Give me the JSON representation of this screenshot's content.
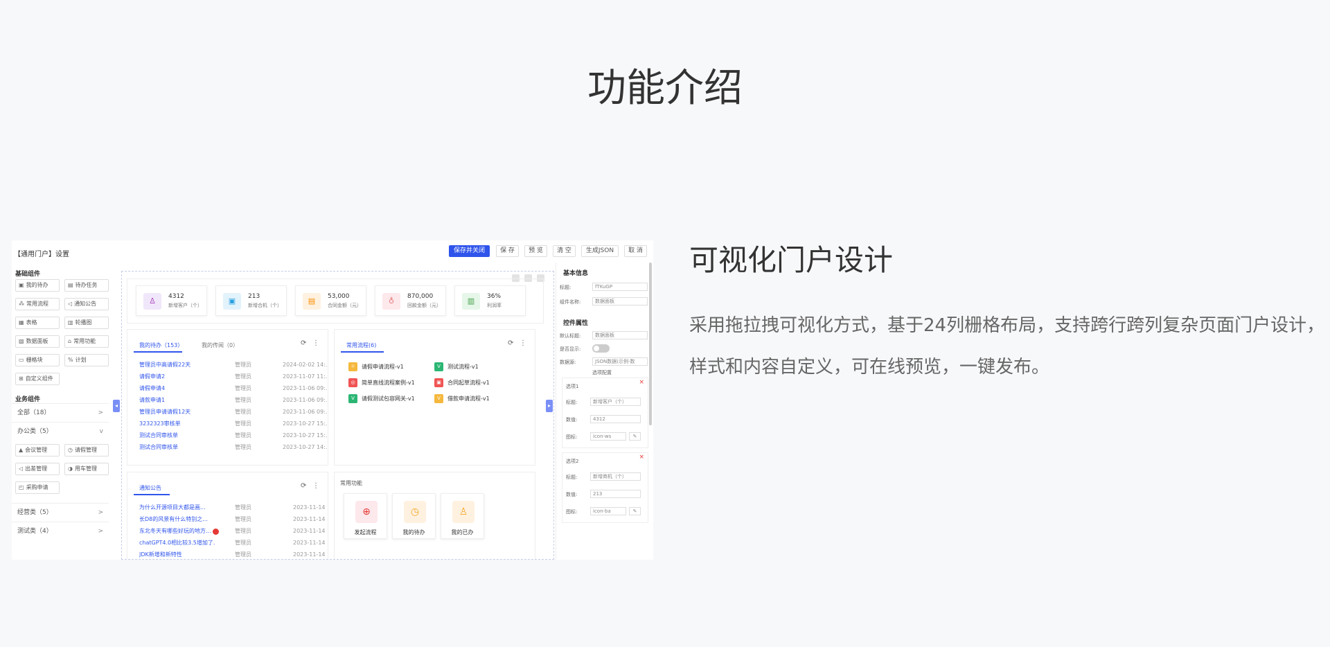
{
  "page": {
    "title": "功能介绍",
    "feature_title": "可视化门户设计",
    "feature_desc": "采用拖拉拽可视化方式，基于24列栅格布局，支持跨行跨列复杂页面门户设计，样式和内容自定义，可在线预览，一键发布。"
  },
  "toolbar": {
    "title": "【通用门户】设置",
    "buttons": [
      "保存并关闭",
      "保 存",
      "预 览",
      "清 空",
      "生成JSON",
      "取 消"
    ]
  },
  "sidebar": {
    "basic_title": "基础组件",
    "basic_items": [
      {
        "icon": "▣",
        "label": "我的待办"
      },
      {
        "icon": "▤",
        "label": "待办任务"
      },
      {
        "icon": "⁂",
        "label": "常用流程"
      },
      {
        "icon": "◁",
        "label": "通知公告"
      },
      {
        "icon": "▦",
        "label": "表格"
      },
      {
        "icon": "▥",
        "label": "轮播图"
      },
      {
        "icon": "▧",
        "label": "数据面板"
      },
      {
        "icon": "⌂",
        "label": "常用功能"
      },
      {
        "icon": "▭",
        "label": "栅格块"
      },
      {
        "icon": "%",
        "label": "计划"
      },
      {
        "icon": "⊞",
        "label": "自定义组件"
      }
    ],
    "business_title": "业务组件",
    "groups": [
      {
        "label": "全部（18）",
        "chevron": ">"
      },
      {
        "label": "办公类（5）",
        "chevron": "v"
      },
      {
        "label": "经营类（5）",
        "chevron": ">"
      },
      {
        "label": "测试类（4）",
        "chevron": ">"
      }
    ],
    "office_items": [
      {
        "icon": "▲",
        "label": "会议管理"
      },
      {
        "icon": "◷",
        "label": "请假管理"
      },
      {
        "icon": "◁",
        "label": "出差管理"
      },
      {
        "icon": "◑",
        "label": "用车管理"
      },
      {
        "icon": "◰",
        "label": "采购申请"
      }
    ]
  },
  "stats": [
    {
      "value": "4312",
      "label": "新增客户（个）",
      "icon": "user-icon",
      "glyph": "♙",
      "bg": "#f1e7fb",
      "fg": "#9c27b0"
    },
    {
      "value": "213",
      "label": "新增合机（个）",
      "icon": "calendar-icon",
      "glyph": "▣",
      "bg": "#e3f3fc",
      "fg": "#29a1e0"
    },
    {
      "value": "53,000",
      "label": "合同金额（元）",
      "icon": "document-icon",
      "glyph": "▤",
      "bg": "#fff1e0",
      "fg": "#fb8c00"
    },
    {
      "value": "870,000",
      "label": "回款金额（元）",
      "icon": "money-bag-icon",
      "glyph": "♁",
      "bg": "#fde8ec",
      "fg": "#e57373"
    },
    {
      "value": "36%",
      "label": "利润率",
      "icon": "bar-chart-icon",
      "glyph": "▥",
      "bg": "#e6f6e9",
      "fg": "#43a047"
    }
  ],
  "todo": {
    "tabs": [
      "我的待办（153）",
      "我的传阅（0）"
    ],
    "rows": [
      {
        "title": "管理员中高请假22天",
        "user": "管理员",
        "date": "2024-02-02 14:..."
      },
      {
        "title": "请假申请2",
        "user": "管理员",
        "date": "2023-11-07 11:..."
      },
      {
        "title": "请假申请4",
        "user": "管理员",
        "date": "2023-11-06 09:..."
      },
      {
        "title": "请款申请1",
        "user": "管理员",
        "date": "2023-11-06 09:..."
      },
      {
        "title": "管理员申请请假12天",
        "user": "管理员",
        "date": "2023-11-06 09:..."
      },
      {
        "title": "3232323审核单",
        "user": "管理员",
        "date": "2023-10-27 15:..."
      },
      {
        "title": "测试合同审核单",
        "user": "管理员",
        "date": "2023-10-27 15:..."
      },
      {
        "title": "测试合同审核单",
        "user": "管理员",
        "date": "2023-10-27 14:..."
      }
    ]
  },
  "processes": {
    "tab": "常用流程(6)",
    "items": [
      {
        "label": "请假申请流程-v1",
        "badge": "☼",
        "color": "#f5b83d"
      },
      {
        "label": "测试流程-v1",
        "badge": "V",
        "color": "#2bb673"
      },
      {
        "label": "简单直线流程案例-v1",
        "badge": "◎",
        "color": "#f05454"
      },
      {
        "label": "合同起草流程-v1",
        "badge": "▣",
        "color": "#f05454"
      },
      {
        "label": "请假测试包容网关-v1",
        "badge": "V",
        "color": "#2bb673"
      },
      {
        "label": "借款申请流程-v1",
        "badge": "V",
        "color": "#f5b83d"
      }
    ]
  },
  "notices": {
    "tab": "通知公告",
    "rows": [
      {
        "title": "为什么开源项目大都是画...",
        "user": "管理员",
        "date": "2023-11-14"
      },
      {
        "title": "长D8的风景有什么特别之...",
        "user": "管理员",
        "date": "2023-11-14"
      },
      {
        "title": "东北冬天有哪些好玩的地方...",
        "user": "管理员",
        "date": "2023-11-14"
      },
      {
        "title": "chatGPT4.0相比较3.5增加了...",
        "user": "管理员",
        "date": "2023-11-14"
      },
      {
        "title": "JDK新增和新特性",
        "user": "管理员",
        "date": "2023-11-14"
      }
    ]
  },
  "quick": {
    "title": "常用功能",
    "items": [
      {
        "label": "发起流程",
        "icon": "plus-circle-icon",
        "glyph": "⊕",
        "bg": "#fde8ec",
        "fg": "#e53935"
      },
      {
        "label": "我的待办",
        "icon": "clock-icon",
        "glyph": "◷",
        "bg": "#fff1e0",
        "fg": "#f5a623"
      },
      {
        "label": "我的已办",
        "icon": "user-check-icon",
        "glyph": "♙",
        "bg": "#fff1e0",
        "fg": "#f5a623"
      }
    ]
  },
  "props": {
    "basic_title": "基本信息",
    "field_title_label": "标题:",
    "field_title_value": "fTKuGP",
    "field_name_label": "组件名称:",
    "field_name_value": "数据面板",
    "ctrl_title": "控件属性",
    "default_title_label": "默认标题:",
    "default_title_value": "数据面板",
    "show_title_label": "是否显示:",
    "data_source_label": "数据源:",
    "data_source_value": "JSON数据(示例-数",
    "options_title": "选项配置",
    "options": [
      {
        "name": "选项1",
        "title_label": "标题:",
        "title": "新增客户（个）",
        "num_label": "数值:",
        "num": "4312",
        "icon_label": "图标:",
        "icon": "icon-ws"
      },
      {
        "name": "选项2",
        "title_label": "标题:",
        "title": "新增商机（个）",
        "num_label": "数值:",
        "num": "213",
        "icon_label": "图标:",
        "icon": "icon-ba"
      }
    ]
  }
}
